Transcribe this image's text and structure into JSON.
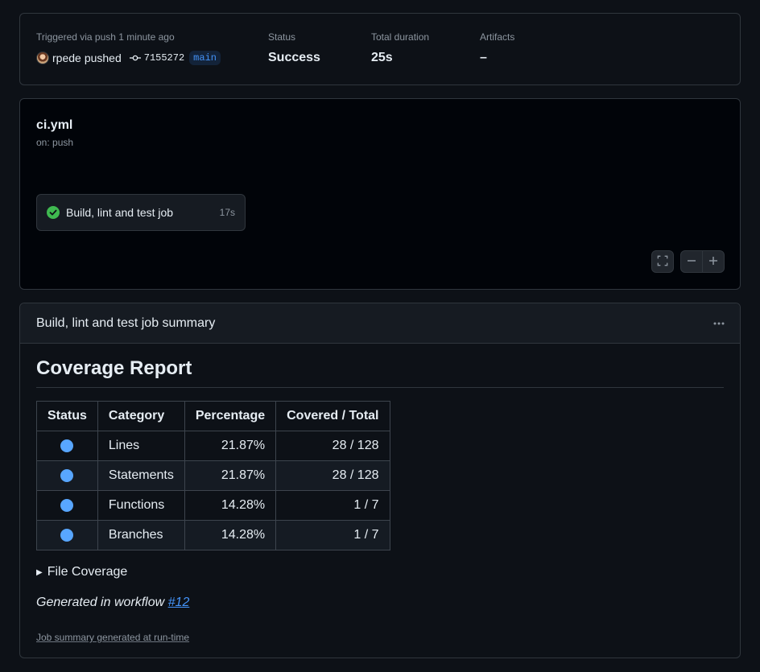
{
  "summary": {
    "trigger_label": "Triggered via push 1 minute ago",
    "actor": "rpede",
    "action": "pushed",
    "commit_sha": "7155272",
    "branch": "main",
    "status_label": "Status",
    "status_value": "Success",
    "duration_label": "Total duration",
    "duration_value": "25s",
    "artifacts_label": "Artifacts",
    "artifacts_value": "–"
  },
  "workflow": {
    "file": "ci.yml",
    "trigger": "on: push",
    "job": {
      "name": "Build, lint and test job",
      "duration": "17s",
      "status_icon": "check-circle-icon",
      "status_color": "#3fb950"
    },
    "controls": {
      "fullscreen_icon": "fullscreen-icon",
      "zoom_out_icon": "minus-icon",
      "zoom_in_icon": "plus-icon"
    }
  },
  "job_summary": {
    "title": "Build, lint and test job summary",
    "menu_icon": "kebab-horizontal-icon",
    "report_title": "Coverage Report",
    "table": {
      "headers": [
        "Status",
        "Category",
        "Percentage",
        "Covered / Total"
      ],
      "rows": [
        {
          "status_color": "#58a6ff",
          "category": "Lines",
          "percentage": "21.87%",
          "covered_total": "28 / 128"
        },
        {
          "status_color": "#58a6ff",
          "category": "Statements",
          "percentage": "21.87%",
          "covered_total": "28 / 128"
        },
        {
          "status_color": "#58a6ff",
          "category": "Functions",
          "percentage": "14.28%",
          "covered_total": "1 / 7"
        },
        {
          "status_color": "#58a6ff",
          "category": "Branches",
          "percentage": "14.28%",
          "covered_total": "1 / 7"
        }
      ]
    },
    "file_coverage_label": "File Coverage",
    "generated_prefix": "Generated in workflow ",
    "generated_link": "#12",
    "footnote": "Job summary generated at run-time"
  },
  "colors": {
    "accent": "#4493f8",
    "success": "#3fb950",
    "coverage_dot": "#58a6ff"
  }
}
